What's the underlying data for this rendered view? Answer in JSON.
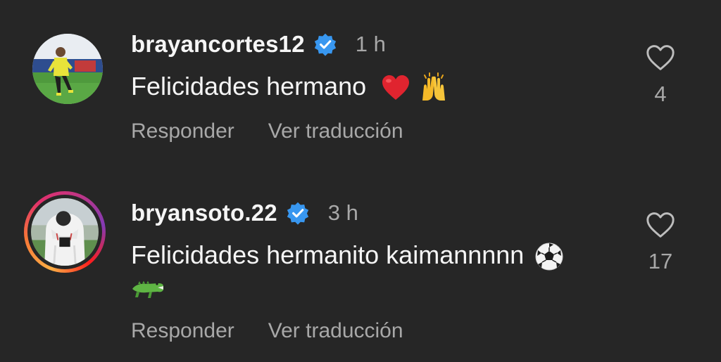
{
  "comments": [
    {
      "username": "brayancortes12",
      "verified": true,
      "time": "1 h",
      "text": "Felicidades hermano",
      "emojis": [
        "red-heart",
        "raising-hands"
      ],
      "reply_label": "Responder",
      "translate_label": "Ver traducción",
      "likes": "4",
      "avatar_has_story_ring": false
    },
    {
      "username": "bryansoto.22",
      "verified": true,
      "time": "3 h",
      "text": "Felicidades hermanito kaimannnnn",
      "emojis": [
        "soccer-ball",
        "crocodile"
      ],
      "reply_label": "Responder",
      "translate_label": "Ver traducción",
      "likes": "17",
      "avatar_has_story_ring": true
    }
  ],
  "colors": {
    "background": "#262626",
    "primary_text": "#f5f5f5",
    "secondary_text": "#a8a8a8",
    "verified_blue": "#3897f0"
  }
}
